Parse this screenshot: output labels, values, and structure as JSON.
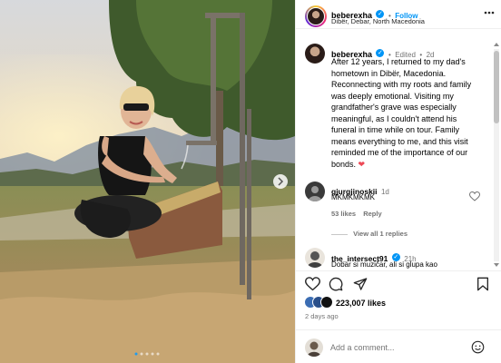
{
  "post": {
    "username": "beberexha",
    "location": "Dibër, Debar, North Macedonia",
    "follow_label": "Follow",
    "separator": "•",
    "edited_label": "Edited",
    "edited_age": "2d",
    "caption_lines": [
      "After 12 years, I returned to my dad's",
      "hometown in Dibër, Macedonia.",
      "Reconnecting with my roots and family",
      "was deeply emotional. Visiting my",
      "grandfather's grave was especially",
      "meaningful, as I couldn't attend his",
      "funeral in time while on tour. Family",
      "means everything to me, and this visit",
      "reminded me of the importance of our",
      "bonds."
    ],
    "heart_emoji": "❤"
  },
  "comments": [
    {
      "username": "gjurgjinoskii",
      "age": "1d",
      "text": "MKMKMKMK",
      "likes": "53 likes",
      "reply_label": "Reply",
      "view_replies": "View all 1 replies"
    },
    {
      "username": "the_intersect91",
      "age": "21h",
      "text": "Dobar si muzičar, ali si glupa kao"
    }
  ],
  "footer": {
    "likes_count": "223,007 likes",
    "post_age": "2 days ago",
    "comment_placeholder": "Add a comment...",
    "emoji_icon": "smiley-icon"
  },
  "colors": {
    "accent": "#0095f6",
    "heart": "#ed4956",
    "muted": "#737373"
  }
}
